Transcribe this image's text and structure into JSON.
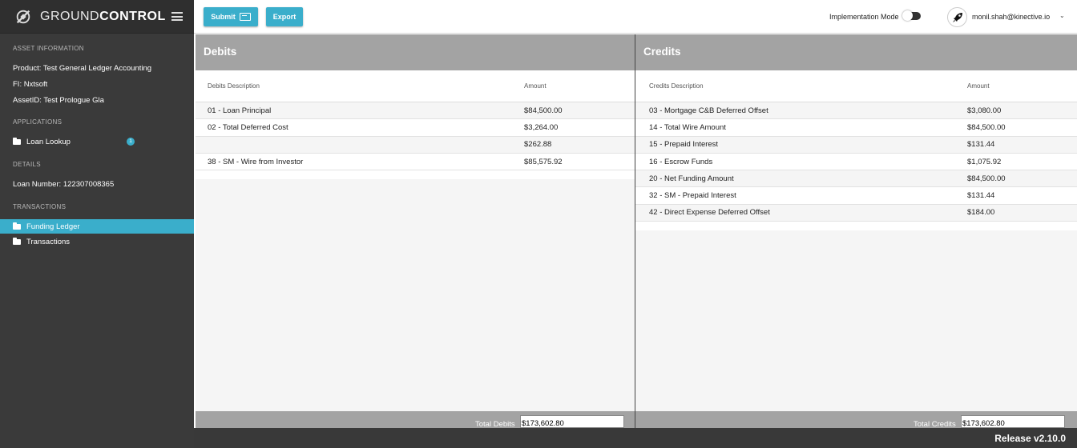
{
  "brand": {
    "name_light": "GROUND",
    "name_bold": "CONTROL"
  },
  "sidebar": {
    "asset_section": "ASSET INFORMATION",
    "product": "Product:  Test General Ledger Accounting",
    "fi": "FI:  Nxtsoft",
    "asset_id": "AssetID:  Test Prologue Gla",
    "applications_section": "APPLICATIONS",
    "loan_lookup": "Loan Lookup",
    "loan_lookup_badge": "1",
    "details_section": "DETAILS",
    "loan_number": "Loan Number:  122307008365",
    "transactions_section": "TRANSACTIONS",
    "funding_ledger": "Funding Ledger",
    "transactions": "Transactions"
  },
  "toolbar": {
    "submit_label": "Submit",
    "export_label": "Export",
    "implementation_mode_label": "Implementation Mode",
    "user_email": "monil.shah@kinective.io"
  },
  "debits": {
    "title": "Debits",
    "col_desc": "Debits Description",
    "col_amount": "Amount",
    "rows": [
      {
        "desc": "01 - Loan Principal",
        "amount": "$84,500.00"
      },
      {
        "desc": "02 - Total Deferred Cost",
        "amount": "$3,264.00"
      },
      {
        "desc": "",
        "amount": "$262.88"
      },
      {
        "desc": "38 - SM - Wire from Investor",
        "amount": "$85,575.92"
      }
    ],
    "total_label": "Total Debits",
    "total_value": "$173,602.80"
  },
  "credits": {
    "title": "Credits",
    "col_desc": "Credits Description",
    "col_amount": "Amount",
    "rows": [
      {
        "desc": "03 - Mortgage C&B Deferred Offset",
        "amount": "$3,080.00"
      },
      {
        "desc": "14 - Total Wire Amount",
        "amount": "$84,500.00"
      },
      {
        "desc": "15 - Prepaid Interest",
        "amount": "$131.44"
      },
      {
        "desc": "16 - Escrow Funds",
        "amount": "$1,075.92"
      },
      {
        "desc": "20 - Net Funding Amount",
        "amount": "$84,500.00"
      },
      {
        "desc": "32 - SM - Prepaid Interest",
        "amount": "$131.44"
      },
      {
        "desc": "42 - Direct Expense Deferred Offset",
        "amount": "$184.00"
      }
    ],
    "total_label": "Total Credits",
    "total_value": "$173,602.80"
  },
  "footer": {
    "release": "Release v2.10.0"
  },
  "colors": {
    "accent": "#3aaecb",
    "sidebar": "#3a3a3a",
    "panel_header": "#a3a3a3"
  }
}
